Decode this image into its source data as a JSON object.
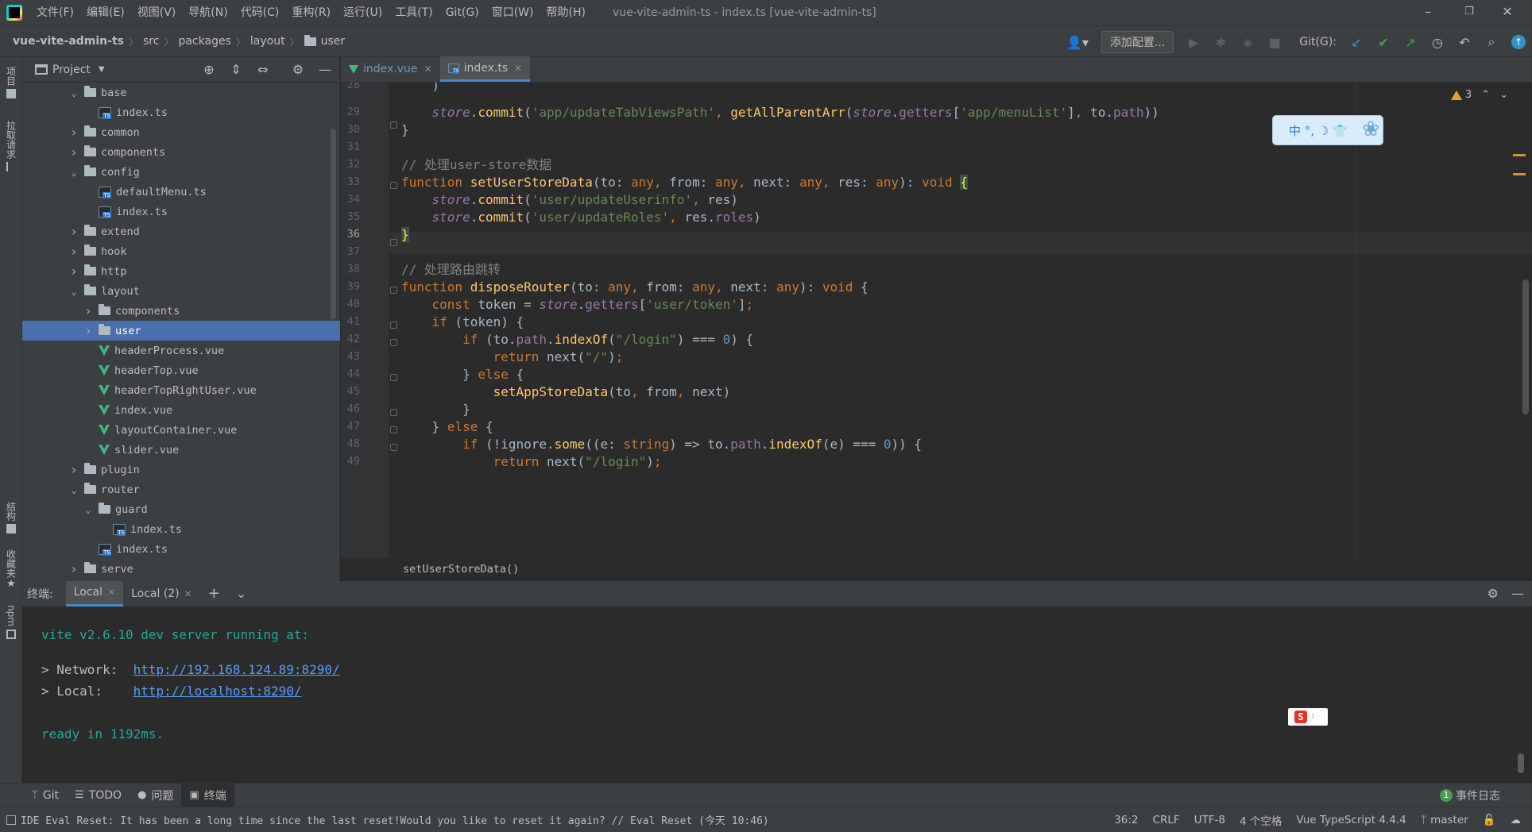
{
  "menubar": {
    "items": [
      "文件(F)",
      "编辑(E)",
      "视图(V)",
      "导航(N)",
      "代码(C)",
      "重构(R)",
      "运行(U)",
      "工具(T)",
      "Git(G)",
      "窗口(W)",
      "帮助(H)"
    ],
    "window_title": "vue-vite-admin-ts - index.ts [vue-vite-admin-ts]",
    "minimize": "–",
    "restore": "❐",
    "close": "✕"
  },
  "navbar": {
    "crumbs": [
      "vue-vite-admin-ts",
      "src",
      "packages",
      "layout",
      "user"
    ],
    "add_config": "添加配置...",
    "git_label": "Git(G):"
  },
  "left_strip": {
    "project_tab": "项目",
    "pull_requests_tab": "拉取请求",
    "structure_tab": "结构",
    "favorites_tab": "收藏夹",
    "npm_tab": "npm"
  },
  "project_panel": {
    "title": "Project",
    "tree": [
      {
        "label": "base",
        "indent": 3,
        "type": "folder",
        "expanded": true
      },
      {
        "label": "index.ts",
        "indent": 4,
        "type": "ts"
      },
      {
        "label": "common",
        "indent": 3,
        "type": "folder",
        "expanded": false
      },
      {
        "label": "components",
        "indent": 3,
        "type": "folder",
        "expanded": false
      },
      {
        "label": "config",
        "indent": 3,
        "type": "folder",
        "expanded": true
      },
      {
        "label": "defaultMenu.ts",
        "indent": 4,
        "type": "ts"
      },
      {
        "label": "index.ts",
        "indent": 4,
        "type": "ts"
      },
      {
        "label": "extend",
        "indent": 3,
        "type": "folder",
        "expanded": false
      },
      {
        "label": "hook",
        "indent": 3,
        "type": "folder",
        "expanded": false
      },
      {
        "label": "http",
        "indent": 3,
        "type": "folder",
        "expanded": false
      },
      {
        "label": "layout",
        "indent": 3,
        "type": "folder",
        "expanded": true
      },
      {
        "label": "components",
        "indent": 4,
        "type": "folder",
        "expanded": false
      },
      {
        "label": "user",
        "indent": 4,
        "type": "folder",
        "expanded": false,
        "selected": true
      },
      {
        "label": "headerProcess.vue",
        "indent": 4,
        "type": "vue"
      },
      {
        "label": "headerTop.vue",
        "indent": 4,
        "type": "vue"
      },
      {
        "label": "headerTopRightUser.vue",
        "indent": 4,
        "type": "vue"
      },
      {
        "label": "index.vue",
        "indent": 4,
        "type": "vue"
      },
      {
        "label": "layoutContainer.vue",
        "indent": 4,
        "type": "vue"
      },
      {
        "label": "slider.vue",
        "indent": 4,
        "type": "vue"
      },
      {
        "label": "plugin",
        "indent": 3,
        "type": "folder",
        "expanded": false
      },
      {
        "label": "router",
        "indent": 3,
        "type": "folder",
        "expanded": true
      },
      {
        "label": "guard",
        "indent": 4,
        "type": "folder",
        "expanded": true
      },
      {
        "label": "index.ts",
        "indent": 5,
        "type": "ts"
      },
      {
        "label": "index.ts",
        "indent": 4,
        "type": "ts"
      },
      {
        "label": "serve",
        "indent": 3,
        "type": "folder",
        "expanded": false
      }
    ]
  },
  "editor": {
    "tabs": [
      {
        "label": "index.vue",
        "type": "vue",
        "active": false
      },
      {
        "label": "index.ts",
        "type": "ts",
        "active": true
      }
    ],
    "warnings_count": "3",
    "line_numbers": [
      "28",
      "29",
      "30",
      "31",
      "32",
      "33",
      "34",
      "35",
      "36",
      "37",
      "38",
      "39",
      "40",
      "41",
      "42",
      "43",
      "44",
      "45",
      "46",
      "47",
      "48",
      "49"
    ],
    "current_line": "36",
    "breadcrumb": "setUserStoreData()",
    "ime_widget": "中 °, ☽ 👕"
  },
  "terminal": {
    "label": "终端:",
    "tabs": [
      {
        "label": "Local",
        "active": true
      },
      {
        "label": "Local (2)",
        "active": false
      }
    ],
    "add": "+",
    "dropdown": "⌄",
    "lines": {
      "server": "vite v2.6.10 dev server running at:",
      "network_prefix": "> Network:  ",
      "network_url": "http://192.168.124.89:8290/",
      "local_prefix": "> Local:    ",
      "local_url": "http://localhost:8290/",
      "ready": "ready in 1192ms."
    },
    "sogou_badge": "S"
  },
  "bottom_tabs": [
    {
      "label": "Git",
      "icon": "ᛘ",
      "active": false
    },
    {
      "label": "TODO",
      "icon": "☰",
      "active": false
    },
    {
      "label": "问题",
      "icon": "●",
      "active": false
    },
    {
      "label": "终端",
      "icon": "▣",
      "active": true
    }
  ],
  "event_log": {
    "count": "1",
    "label": "事件日志"
  },
  "statusbar": {
    "message": "IDE Eval Reset: It has been a long time since the last reset!Would you like to reset it again? // Eval Reset (今天 10:46)",
    "position": "36:2",
    "line_sep": "CRLF",
    "encoding": "UTF-8",
    "indent": "4 个空格",
    "language": "Vue TypeScript 4.4.4",
    "branch": "master"
  }
}
